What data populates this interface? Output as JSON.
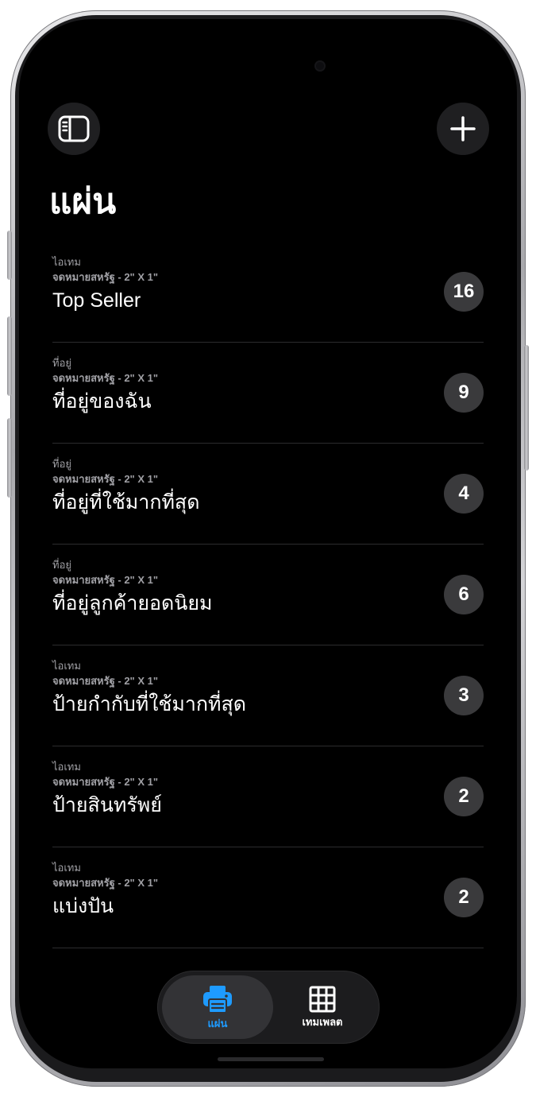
{
  "header": {
    "title": "แผ่น"
  },
  "sheets": [
    {
      "kind": "ไอเทม",
      "format": "จดหมายสหรัฐ - 2\" X 1\"",
      "name": "Top Seller",
      "count": "16"
    },
    {
      "kind": "ที่อยู่",
      "format": "จดหมายสหรัฐ - 2\" X 1\"",
      "name": "ที่อยู่ของฉัน",
      "count": "9"
    },
    {
      "kind": "ที่อยู่",
      "format": "จดหมายสหรัฐ - 2\" X 1\"",
      "name": "ที่อยู่ที่ใช้มากที่สุด",
      "count": "4"
    },
    {
      "kind": "ที่อยู่",
      "format": "จดหมายสหรัฐ - 2\" X 1\"",
      "name": "ที่อยู่ลูกค้ายอดนิยม",
      "count": "6"
    },
    {
      "kind": "ไอเทม",
      "format": "จดหมายสหรัฐ - 2\" X 1\"",
      "name": "ป้ายกำกับที่ใช้มากที่สุด",
      "count": "3"
    },
    {
      "kind": "ไอเทม",
      "format": "จดหมายสหรัฐ - 2\" X 1\"",
      "name": "ป้ายสินทรัพย์",
      "count": "2"
    },
    {
      "kind": "ไอเทม",
      "format": "จดหมายสหรัฐ - 2\" X 1\"",
      "name": "แบ่งปัน",
      "count": "2"
    }
  ],
  "tabs": [
    {
      "label": "แผ่น",
      "icon": "printer-icon",
      "active": true
    },
    {
      "label": "เทมเพลต",
      "icon": "grid-icon",
      "active": false
    }
  ],
  "colors": {
    "background": "#000000",
    "accent": "#1e9bff",
    "badge": "#3a3a3c",
    "secondary_text": "#a0a0a5"
  }
}
